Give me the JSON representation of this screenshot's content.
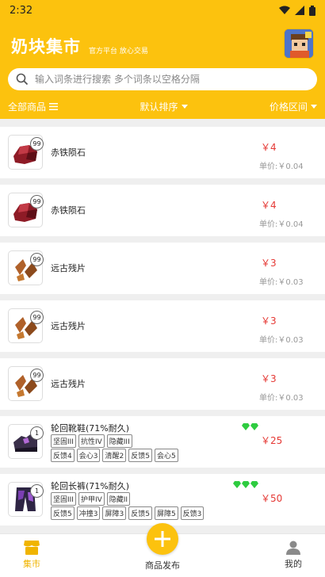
{
  "status": {
    "time": "2:32"
  },
  "header": {
    "title": "奶块集市",
    "subtitle": "官方平台 放心交易"
  },
  "search": {
    "placeholder": "输入词条进行搜索 多个词条以空格分隔"
  },
  "filters": {
    "all": "全部商品",
    "sort": "默认排序",
    "price": "价格区间"
  },
  "colors": {
    "accent": "#fcc20e",
    "price": "#e53935"
  },
  "items": [
    {
      "name": "赤铁陨石",
      "count": "99",
      "price": "￥4",
      "unit": "单价:￥0.04",
      "icon": "red-ore-icon"
    },
    {
      "name": "赤铁陨石",
      "count": "99",
      "price": "￥4",
      "unit": "单价:￥0.04",
      "icon": "red-ore-icon"
    },
    {
      "name": "远古残片",
      "count": "99",
      "price": "￥3",
      "unit": "单价:￥0.03",
      "icon": "ancient-fragment-icon"
    },
    {
      "name": "远古残片",
      "count": "99",
      "price": "￥3",
      "unit": "单价:￥0.03",
      "icon": "ancient-fragment-icon"
    },
    {
      "name": "远古残片",
      "count": "99",
      "price": "￥3",
      "unit": "单价:￥0.03",
      "icon": "ancient-fragment-icon"
    }
  ],
  "equips": [
    {
      "name": "轮回靴鞋(71%耐久)",
      "count": "1",
      "price": "￥25",
      "gems": 2,
      "icon": "boots-icon",
      "tags_row1": [
        "坚固III",
        "抗性IV",
        "隐藏III"
      ],
      "tags_row2": [
        "反馈4",
        "会心3",
        "清醒2",
        "反馈5",
        "会心5"
      ]
    },
    {
      "name": "轮回长裤(71%耐久)",
      "count": "1",
      "price": "￥50",
      "gems": 3,
      "icon": "pants-icon",
      "tags_row1": [
        "坚固III",
        "护甲IV",
        "隐藏II"
      ],
      "tags_row2": [
        "反馈5",
        "冲撞3",
        "屏障3",
        "反馈5",
        "屏障5",
        "反馈3"
      ]
    }
  ],
  "tabbar": {
    "market": "集市",
    "publish": "商品发布",
    "mine": "我的"
  }
}
